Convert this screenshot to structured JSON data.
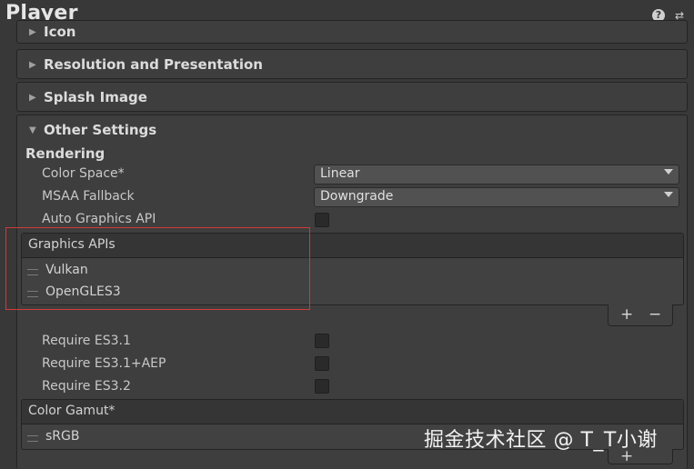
{
  "header": {
    "title": "Player"
  },
  "foldouts": {
    "icon": "Icon",
    "resolution": "Resolution and Presentation",
    "splash": "Splash Image",
    "other": "Other Settings"
  },
  "rendering": {
    "section": "Rendering",
    "color_space": {
      "label": "Color Space*",
      "value": "Linear"
    },
    "msaa_fallback": {
      "label": "MSAA Fallback",
      "value": "Downgrade"
    },
    "auto_graphics_api": {
      "label": "Auto Graphics API",
      "checked": false
    }
  },
  "graphics_apis": {
    "header": "Graphics APIs",
    "items": [
      "Vulkan",
      "OpenGLES3"
    ]
  },
  "require": {
    "es31": {
      "label": "Require ES3.1",
      "checked": false
    },
    "es31aep": {
      "label": "Require ES3.1+AEP",
      "checked": false
    },
    "es32": {
      "label": "Require ES3.2",
      "checked": false
    }
  },
  "color_gamut": {
    "header": "Color Gamut*",
    "items": [
      "sRGB"
    ]
  },
  "list_controls": {
    "add": "+",
    "remove": "−"
  },
  "watermark": "掘金技术社区 @ T_T小谢",
  "colors": {
    "highlight": "#d23a3a",
    "background": "#383838"
  }
}
